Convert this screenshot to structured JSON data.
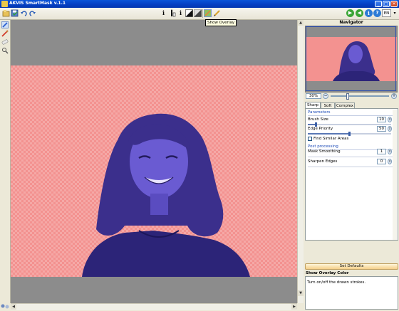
{
  "window": {
    "title": "AKVIS SmartMask v.1.1",
    "minimize_icon": "_",
    "maximize_icon": "□",
    "close_icon": "×"
  },
  "toolbar": {
    "left_icons": [
      "open-icon",
      "save-icon",
      "undo-icon",
      "redo-icon"
    ],
    "center_icons": [
      "info-icon",
      "keep-mask-icon",
      "remove-icon",
      "mask-mode-icon",
      "background-mode-icon",
      "show-overlay-icon",
      "show-strokes-icon"
    ],
    "right_icons": [
      "run-icon",
      "back-icon",
      "info-circle-icon",
      "help-icon"
    ],
    "language": "EN"
  },
  "tooltip": {
    "text": "Show Overlay"
  },
  "left_tools": [
    "blue-pencil-icon",
    "red-pencil-icon",
    "eraser-icon",
    "hand-icon"
  ],
  "navigator": {
    "title": "Navigator",
    "zoom": "30%"
  },
  "tabs": [
    {
      "label": "Sharp",
      "active": true
    },
    {
      "label": "Soft",
      "active": false
    },
    {
      "label": "Complex",
      "active": false
    }
  ],
  "parameters": {
    "heading": "Parameters",
    "brush_size": {
      "label": "Brush Size",
      "value": "10",
      "fraction": 0.1
    },
    "edge_priority": {
      "label": "Edge Priority",
      "value": "50",
      "fraction": 0.5
    },
    "find_similar": {
      "label": "Find Similar Areas",
      "checked": false
    }
  },
  "post_processing": {
    "heading": "Post processing",
    "mask_smoothing": {
      "label": "Mask Smoothing",
      "value": "1"
    },
    "sharpen_edges": {
      "label": "Sharpen Edges",
      "value": "0"
    }
  },
  "buttons": {
    "set_defaults": "Set Defaults"
  },
  "help": {
    "title": "Show Overlay Color",
    "text": "Turn on/off the drawn strokes."
  },
  "colors": {
    "overlay": "#f39290",
    "subject_tint": "#3b2f8c",
    "canvas_bg": "#8c8c8c",
    "titlebar": "#0a55d9"
  }
}
